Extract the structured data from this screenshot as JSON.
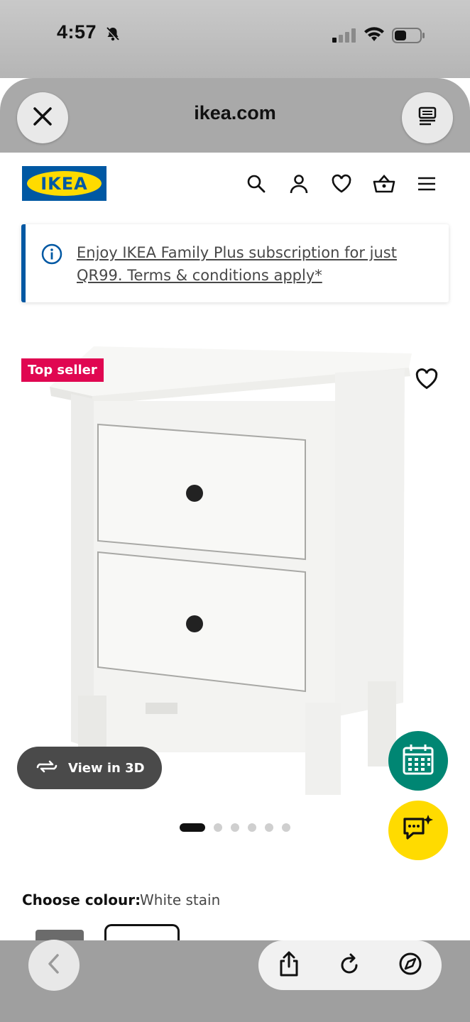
{
  "status_bar": {
    "time": "4:57",
    "icons": [
      "bell-slash-icon",
      "cellular-signal-icon",
      "wifi-icon",
      "battery-icon"
    ]
  },
  "browser": {
    "url": "ikea.com",
    "close_icon": "close-icon",
    "reader_icon": "reader-view-icon"
  },
  "site_header": {
    "logo_text": "IKEA",
    "icons": [
      "search-icon",
      "account-icon",
      "heart-icon",
      "basket-icon",
      "menu-icon"
    ]
  },
  "banner": {
    "text": "Enjoy IKEA Family Plus subscription for just QR99. Terms & conditions apply*",
    "icon": "info-icon"
  },
  "product": {
    "badge": "Top seller",
    "view_3d_label": "View in 3D",
    "image_count": 6,
    "active_image": 1
  },
  "colour": {
    "label": "Choose colour:",
    "value": "White stain"
  },
  "colors": {
    "ikea_blue": "#0058a3",
    "ikea_yellow": "#ffdb00",
    "badge_red": "#e00751",
    "calendar_green": "#008673"
  }
}
